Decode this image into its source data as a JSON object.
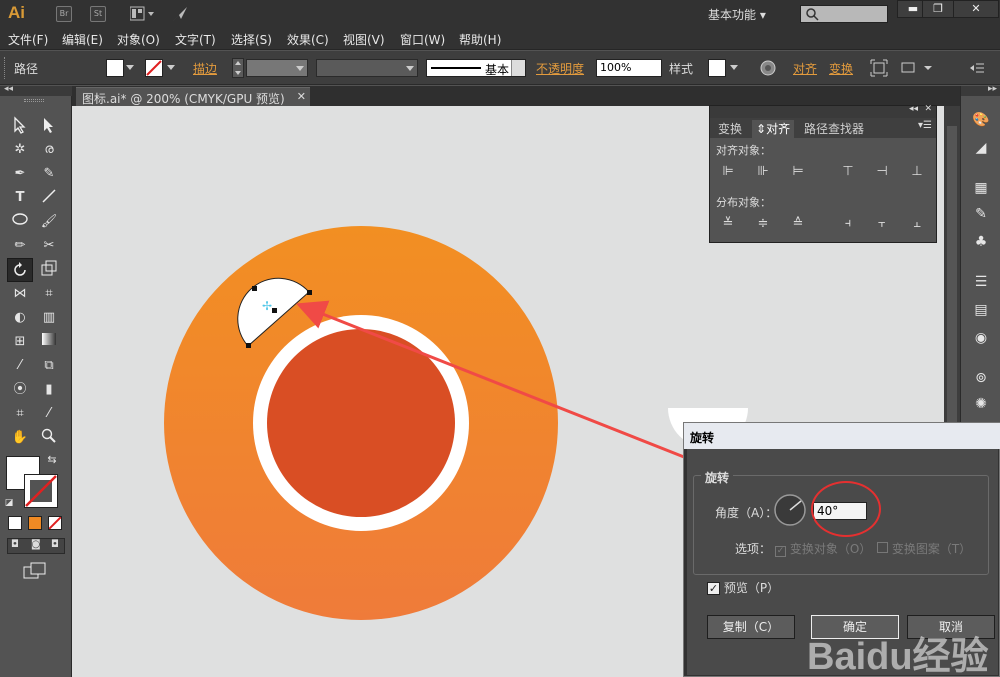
{
  "app": {
    "logo": "Ai",
    "br_label": "Br",
    "st_label": "St",
    "workspace": "基本功能",
    "accent": "#d99a36"
  },
  "window_controls": {
    "minimize": "▬",
    "restore": "❐",
    "close": "✕"
  },
  "menu": [
    "文件(F)",
    "编辑(E)",
    "对象(O)",
    "文字(T)",
    "选择(S)",
    "效果(C)",
    "视图(V)",
    "窗口(W)",
    "帮助(H)"
  ],
  "control_bar": {
    "selection_type": "路径",
    "stroke_label": "描边",
    "profile_label": "基本",
    "opacity_label": "不透明度",
    "opacity_value": "100%",
    "style_label": "样式",
    "align_label": "对齐",
    "transform_label": "变换"
  },
  "document": {
    "tab_title": "图标.ai* @ 200% (CMYK/GPU 预览)",
    "close_icon": "✕"
  },
  "align_panel": {
    "tabs": [
      "变换",
      "对齐",
      "路径查找器"
    ],
    "active_tab": "对齐",
    "align_objects_label": "对齐对象：",
    "distribute_objects_label": "分布对象："
  },
  "rotate_dialog": {
    "title": "旋转",
    "group_label": "旋转",
    "angle_label": "角度（A）：",
    "angle_value": "40°",
    "options_label": "选项：",
    "transform_objects": {
      "label": "变换对象（O）",
      "checked": true
    },
    "transform_patterns": {
      "label": "变换图案（T）",
      "checked": false
    },
    "preview": {
      "label": "预览（P）",
      "checked": true
    },
    "buttons": {
      "copy": "复制（C）",
      "ok": "确定",
      "cancel": "取消"
    }
  },
  "artwork": {
    "outer_color_top": "#f28f22",
    "outer_color_bottom": "#ef7b3a",
    "ring_color": "#ffffff",
    "inner_color": "#d94e24",
    "annotation_color": "#f04a46"
  },
  "watermark": {
    "text": "Baidu经验"
  }
}
